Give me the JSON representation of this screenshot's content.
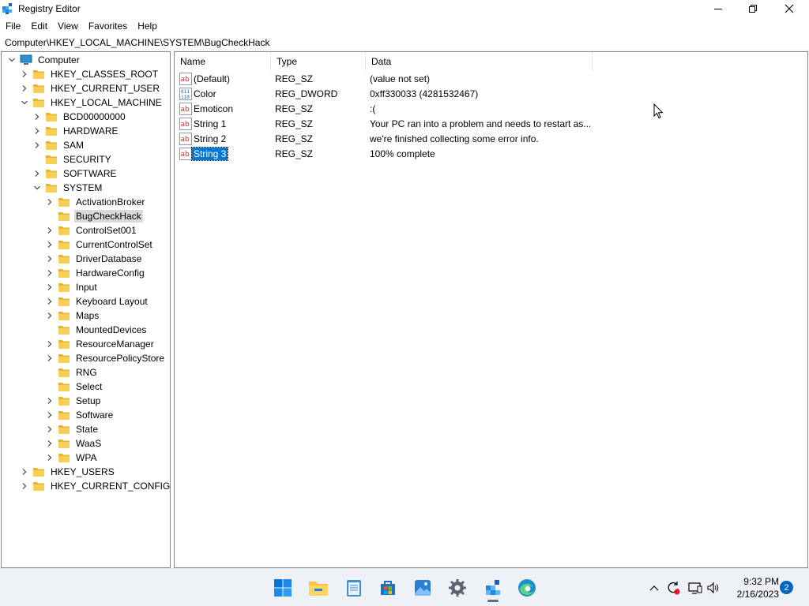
{
  "window": {
    "title": "Registry Editor"
  },
  "menu": [
    "File",
    "Edit",
    "View",
    "Favorites",
    "Help"
  ],
  "address": "Computer\\HKEY_LOCAL_MACHINE\\SYSTEM\\BugCheckHack",
  "tree": [
    {
      "label": "Computer",
      "level": 0,
      "expander": "expanded",
      "icon": "computer-icon"
    },
    {
      "label": "HKEY_CLASSES_ROOT",
      "level": 1,
      "expander": "collapsed",
      "icon": "folder-icon"
    },
    {
      "label": "HKEY_CURRENT_USER",
      "level": 1,
      "expander": "collapsed",
      "icon": "folder-icon"
    },
    {
      "label": "HKEY_LOCAL_MACHINE",
      "level": 1,
      "expander": "expanded",
      "icon": "folder-icon"
    },
    {
      "label": "BCD00000000",
      "level": 2,
      "expander": "collapsed",
      "icon": "folder-icon"
    },
    {
      "label": "HARDWARE",
      "level": 2,
      "expander": "collapsed",
      "icon": "folder-icon"
    },
    {
      "label": "SAM",
      "level": 2,
      "expander": "collapsed",
      "icon": "folder-icon"
    },
    {
      "label": "SECURITY",
      "level": 2,
      "expander": "none",
      "icon": "folder-icon"
    },
    {
      "label": "SOFTWARE",
      "level": 2,
      "expander": "collapsed",
      "icon": "folder-icon"
    },
    {
      "label": "SYSTEM",
      "level": 2,
      "expander": "expanded",
      "icon": "folder-icon"
    },
    {
      "label": "ActivationBroker",
      "level": 3,
      "expander": "collapsed",
      "icon": "folder-icon"
    },
    {
      "label": "BugCheckHack",
      "level": 3,
      "expander": "none",
      "icon": "folder-icon",
      "selected": true
    },
    {
      "label": "ControlSet001",
      "level": 3,
      "expander": "collapsed",
      "icon": "folder-icon"
    },
    {
      "label": "CurrentControlSet",
      "level": 3,
      "expander": "collapsed",
      "icon": "folder-icon"
    },
    {
      "label": "DriverDatabase",
      "level": 3,
      "expander": "collapsed",
      "icon": "folder-icon"
    },
    {
      "label": "HardwareConfig",
      "level": 3,
      "expander": "collapsed",
      "icon": "folder-icon"
    },
    {
      "label": "Input",
      "level": 3,
      "expander": "collapsed",
      "icon": "folder-icon"
    },
    {
      "label": "Keyboard Layout",
      "level": 3,
      "expander": "collapsed",
      "icon": "folder-icon"
    },
    {
      "label": "Maps",
      "level": 3,
      "expander": "collapsed",
      "icon": "folder-icon"
    },
    {
      "label": "MountedDevices",
      "level": 3,
      "expander": "none",
      "icon": "folder-icon"
    },
    {
      "label": "ResourceManager",
      "level": 3,
      "expander": "collapsed",
      "icon": "folder-icon"
    },
    {
      "label": "ResourcePolicyStore",
      "level": 3,
      "expander": "collapsed",
      "icon": "folder-icon"
    },
    {
      "label": "RNG",
      "level": 3,
      "expander": "none",
      "icon": "folder-icon"
    },
    {
      "label": "Select",
      "level": 3,
      "expander": "none",
      "icon": "folder-icon"
    },
    {
      "label": "Setup",
      "level": 3,
      "expander": "collapsed",
      "icon": "folder-icon"
    },
    {
      "label": "Software",
      "level": 3,
      "expander": "collapsed",
      "icon": "folder-icon"
    },
    {
      "label": "State",
      "level": 3,
      "expander": "collapsed",
      "icon": "folder-icon"
    },
    {
      "label": "WaaS",
      "level": 3,
      "expander": "collapsed",
      "icon": "folder-icon"
    },
    {
      "label": "WPA",
      "level": 3,
      "expander": "collapsed",
      "icon": "folder-icon"
    },
    {
      "label": "HKEY_USERS",
      "level": 1,
      "expander": "collapsed",
      "icon": "folder-icon"
    },
    {
      "label": "HKEY_CURRENT_CONFIG",
      "level": 1,
      "expander": "collapsed",
      "icon": "folder-icon"
    }
  ],
  "columns": [
    "Name",
    "Type",
    "Data"
  ],
  "values": [
    {
      "name": "(Default)",
      "type": "REG_SZ",
      "data": "(value not set)",
      "icon": "string-value-icon"
    },
    {
      "name": "Color",
      "type": "REG_DWORD",
      "data": "0xff330033 (4281532467)",
      "icon": "binary-value-icon"
    },
    {
      "name": "Emoticon",
      "type": "REG_SZ",
      "data": ":(",
      "icon": "string-value-icon"
    },
    {
      "name": "String 1",
      "type": "REG_SZ",
      "data": "Your PC  ran into a problem and needs to restart as...",
      "icon": "string-value-icon"
    },
    {
      "name": "String 2",
      "type": "REG_SZ",
      "data": "we're finished collecting some error info.",
      "icon": "string-value-icon"
    },
    {
      "name": "String 3",
      "type": "REG_SZ",
      "data": "100% complete",
      "icon": "string-value-icon",
      "selected": true
    }
  ],
  "taskbar": {
    "apps": [
      "start-icon",
      "file-explorer-icon",
      "notepad-icon",
      "store-icon",
      "photos-icon",
      "settings-icon",
      "registry-editor-icon",
      "edge-icon"
    ],
    "active_app": "registry-editor-icon",
    "tray": [
      "chevron-up-icon",
      "update-icon",
      "display-icon",
      "volume-icon"
    ],
    "time": "9:32 PM",
    "date": "2/16/2023",
    "notifications": "2"
  },
  "colors": {
    "selection": "#0078d7",
    "folder": "#f5c342",
    "taskbar": "#eef2f6"
  }
}
